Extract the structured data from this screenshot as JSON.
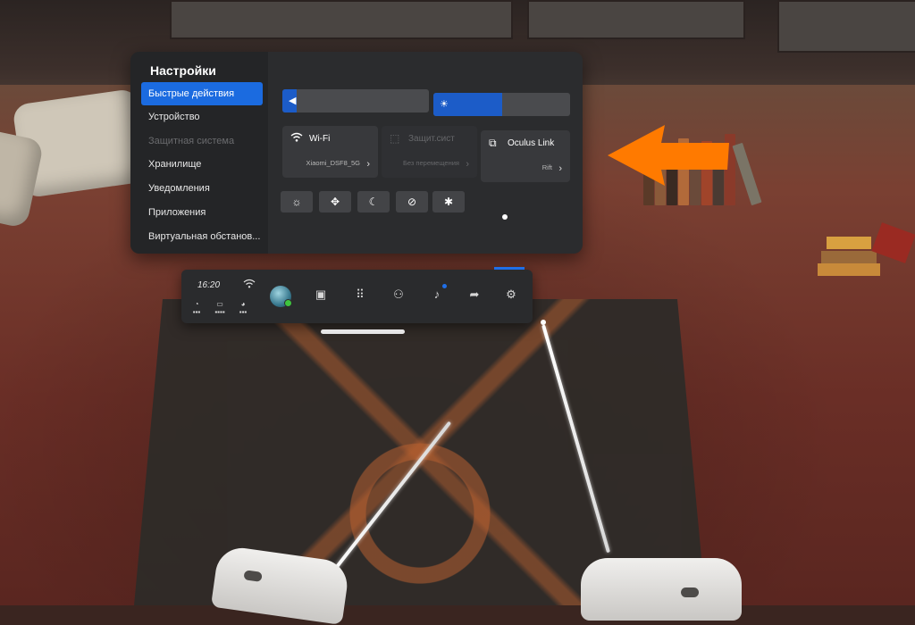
{
  "settings": {
    "title": "Настройки",
    "nav": [
      {
        "label": "Быстрые действия",
        "state": "active"
      },
      {
        "label": "Устройство",
        "state": "normal"
      },
      {
        "label": "Защитная система",
        "state": "disabled"
      },
      {
        "label": "Хранилище",
        "state": "normal"
      },
      {
        "label": "Уведомления",
        "state": "normal"
      },
      {
        "label": "Приложения",
        "state": "normal"
      },
      {
        "label": "Виртуальная обстанов...",
        "state": "normal"
      }
    ],
    "volume_slider": {
      "icon": "speaker-icon",
      "level": 0.03
    },
    "brightness_slider": {
      "icon": "sun-icon",
      "level": 0.5
    },
    "tiles": {
      "wifi": {
        "name": "Wi-Fi",
        "sub": "Xiaomi_DSF8_5G",
        "icon": "wifi-icon"
      },
      "guardian": {
        "name": "Защит.сист",
        "sub": "Без перемещения",
        "icon": "guardian-icon",
        "state": "disabled"
      },
      "oculus_link": {
        "name": "Oculus Link",
        "sub": "Rift",
        "icon": "link-icon"
      }
    },
    "quick_buttons": [
      "brightness-icon",
      "recenter-icon",
      "night-mode-icon",
      "mic-mute-icon",
      "bug-report-icon"
    ]
  },
  "menubar": {
    "time": "16:20",
    "icons": [
      "store-icon",
      "apps-icon",
      "people-icon",
      "notifications-icon",
      "share-icon",
      "settings-icon"
    ]
  },
  "colors": {
    "accent": "#1b6be0",
    "panel": "#2b2c2e",
    "annotation_arrow": "#ff7a00"
  }
}
